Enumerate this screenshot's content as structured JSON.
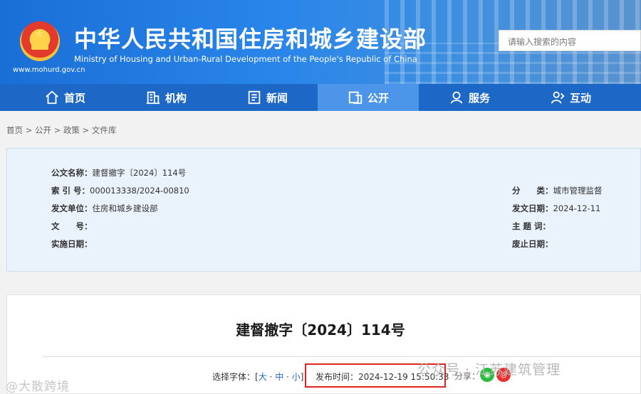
{
  "header": {
    "title_cn": "中华人民共和国住房和城乡建设部",
    "title_en": "Ministry of Housing and Urban-Rural Development of the People's Republic of China",
    "site_url": "www.mohurd.gov.cn",
    "search_placeholder": "请输入搜索的内容"
  },
  "nav": {
    "items": [
      {
        "label": "首页",
        "icon": "home-icon"
      },
      {
        "label": "机构",
        "icon": "building-icon"
      },
      {
        "label": "新闻",
        "icon": "news-icon"
      },
      {
        "label": "公开",
        "icon": "disclosure-icon",
        "active": true
      },
      {
        "label": "服务",
        "icon": "service-icon"
      },
      {
        "label": "互动",
        "icon": "interaction-icon"
      }
    ]
  },
  "breadcrumb": "首页 > 公开 > 政策 > 文件库",
  "info": {
    "doc_name_label": "公文名称：",
    "doc_name_value": "建督撤字〔2024〕114号",
    "index_label": "索 引 号：",
    "index_value": "000013338/2024-00810",
    "issuer_label": "发文单位：",
    "issuer_value": "住房和城乡建设部",
    "doc_no_label": "文　　号：",
    "doc_no_value": "",
    "effective_label": "实施日期：",
    "effective_value": "",
    "category_label": "分　　类：",
    "category_value": "城市管理监督",
    "issue_date_label": "发文日期：",
    "issue_date_value": "2024-12-11",
    "subject_label": "主 题 词：",
    "subject_value": "",
    "abolish_label": "废止日期：",
    "abolish_value": ""
  },
  "document": {
    "title": "建督撤字〔2024〕114号",
    "font_select_label": "选择字体：[",
    "font_large": "大",
    "font_medium": "中",
    "font_small": "小",
    "font_close": "]",
    "sep": "·",
    "publish_time": "发布时间：2024-12-19 15:50:33",
    "share_label": "分享："
  },
  "watermarks": {
    "right": "公众号 · 江苏建筑管理",
    "left": "@大散跨境"
  },
  "colors": {
    "header_blue": "#1a6fd6",
    "nav_blue": "#1d68c7",
    "nav_active": "#4d95e8",
    "highlight_red": "#e32222"
  }
}
